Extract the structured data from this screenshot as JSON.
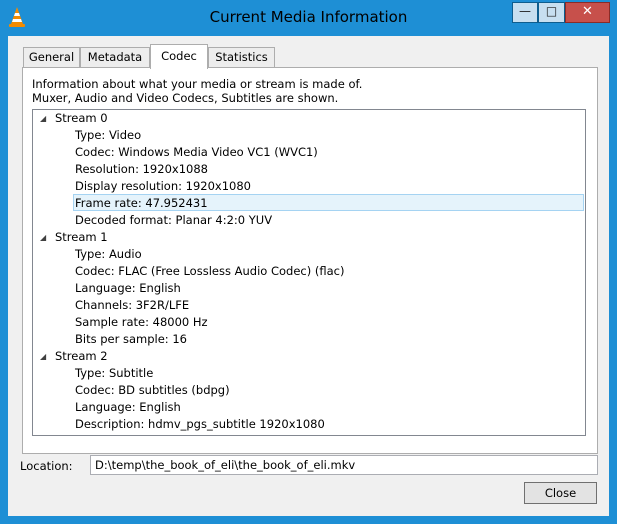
{
  "window": {
    "title": "Current Media Information",
    "controls": {
      "minimize": "—",
      "maximize": "□",
      "close": "✕"
    },
    "icon": "vlc-cone-icon"
  },
  "tabs": [
    {
      "label": "General",
      "selected": false
    },
    {
      "label": "Metadata",
      "selected": false
    },
    {
      "label": "Codec",
      "selected": true
    },
    {
      "label": "Statistics",
      "selected": false
    }
  ],
  "codec": {
    "info_line_1": "Information about what your media or stream is made of.",
    "info_line_2": "Muxer, Audio and Video Codecs, Subtitles are shown.",
    "streams": [
      {
        "label": "Stream 0",
        "properties": [
          "Type: Video",
          "Codec: Windows Media Video VC1 (WVC1)",
          "Resolution: 1920x1088",
          "Display resolution: 1920x1080",
          "Frame rate: 47.952431",
          "Decoded format: Planar 4:2:0 YUV"
        ]
      },
      {
        "label": "Stream 1",
        "properties": [
          "Type: Audio",
          "Codec: FLAC (Free Lossless Audio Codec) (flac)",
          "Language: English",
          "Channels: 3F2R/LFE",
          "Sample rate: 48000 Hz",
          "Bits per sample: 16"
        ]
      },
      {
        "label": "Stream 2",
        "properties": [
          "Type: Subtitle",
          "Codec: BD subtitles (bdpg)",
          "Language: English",
          "Description: hdmv_pgs_subtitle 1920x1080"
        ]
      }
    ],
    "selected_item": "Frame rate: 47.952431",
    "expander_glyph": "◢"
  },
  "location": {
    "label": "Location:",
    "value": "D:\\temp\\the_book_of_eli\\the_book_of_eli.mkv"
  },
  "buttons": {
    "close": "Close"
  },
  "colors": {
    "frame": "#1e8fd5",
    "selection": "#e5f3fb",
    "close_button": "#c7504b"
  }
}
